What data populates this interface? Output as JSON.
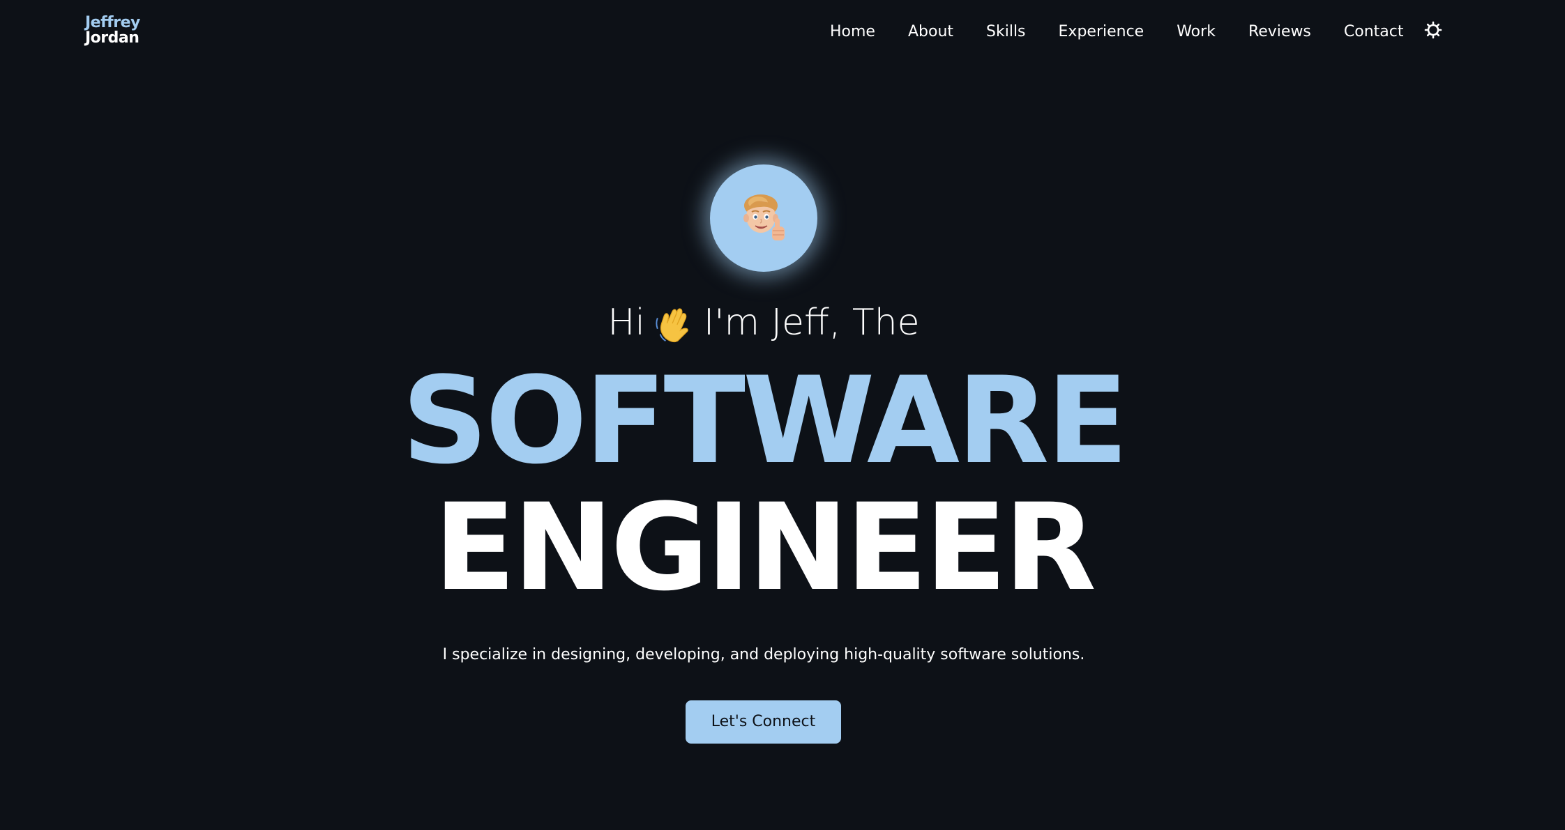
{
  "logo": {
    "first_name": "Jeffrey",
    "last_name": "Jordan"
  },
  "nav": {
    "items": [
      {
        "label": "Home"
      },
      {
        "label": "About"
      },
      {
        "label": "Skills"
      },
      {
        "label": "Experience"
      },
      {
        "label": "Work"
      },
      {
        "label": "Reviews"
      },
      {
        "label": "Contact"
      }
    ],
    "theme_toggle_icon": "sun-icon"
  },
  "hero": {
    "avatar_icon": "memoji-thumbs-up-icon",
    "greeting_before": "Hi",
    "wave_icon": "waving-hand-icon",
    "greeting_after": "I'm Jeff, The",
    "title_line_1": "SOFTWARE",
    "title_line_2": "ENGINEER",
    "tagline": "I specialize in designing, developing, and deploying high-quality software solutions.",
    "cta_label": "Let's Connect"
  },
  "colors": {
    "background": "#0d1117",
    "accent": "#a3cdf1",
    "text": "#ffffff"
  }
}
